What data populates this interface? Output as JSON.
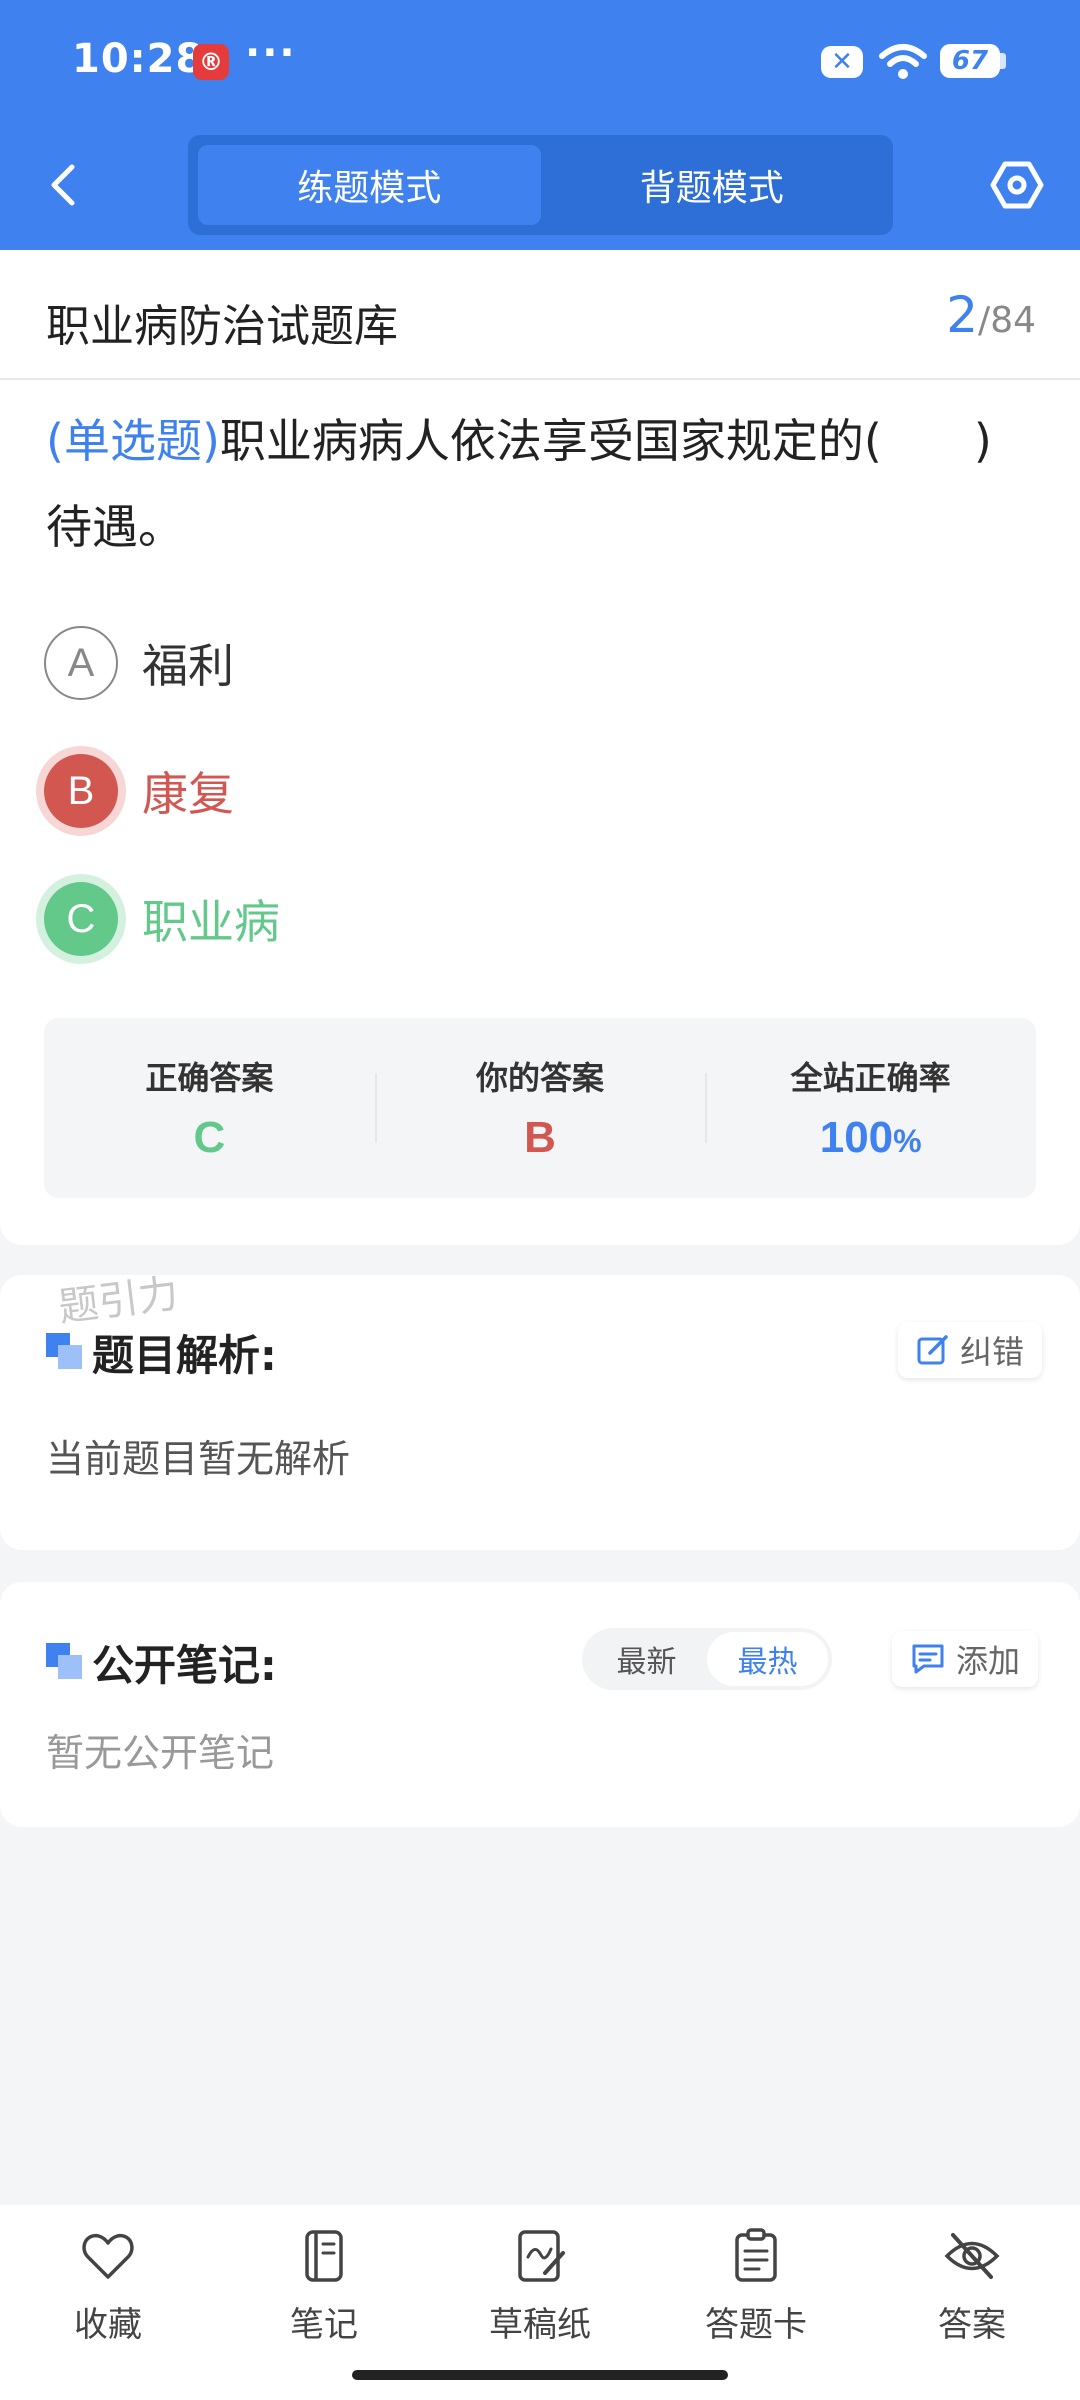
{
  "status_bar": {
    "time": "10:28",
    "app_badge": "®",
    "more": "···",
    "x_badge": "✕",
    "battery": "67"
  },
  "header": {
    "tabs": [
      {
        "label": "练题模式",
        "active": true
      },
      {
        "label": "背题模式",
        "active": false
      }
    ]
  },
  "question_header": {
    "bank_title": "职业病防治试题库",
    "current": "2",
    "separator": "/",
    "total": "84"
  },
  "question": {
    "type_label": "(单选题)",
    "text": "职业病病人依法享受国家规定的(　　)待遇。"
  },
  "options": [
    {
      "letter": "A",
      "text": "福利",
      "state": "normal"
    },
    {
      "letter": "B",
      "text": "康复",
      "state": "wrong"
    },
    {
      "letter": "C",
      "text": "职业病",
      "state": "correct"
    }
  ],
  "stats": {
    "correct_label": "正确答案",
    "correct_value": "C",
    "yours_label": "你的答案",
    "yours_value": "B",
    "rate_label": "全站正确率",
    "rate_value": "100",
    "rate_unit": "%"
  },
  "analysis": {
    "watermark": "题引力",
    "title": "题目解析:",
    "report_label": "纠错",
    "empty_text": "当前题目暂无解析"
  },
  "notes": {
    "title": "公开笔记:",
    "sort_options": [
      {
        "label": "最新",
        "active": false
      },
      {
        "label": "最热",
        "active": true
      }
    ],
    "add_label": "添加",
    "empty_text": "暂无公开笔记"
  },
  "bottom_nav": [
    {
      "label": "收藏",
      "icon": "heart-icon"
    },
    {
      "label": "笔记",
      "icon": "notebook-icon"
    },
    {
      "label": "草稿纸",
      "icon": "draft-paper-icon"
    },
    {
      "label": "答题卡",
      "icon": "answer-card-icon"
    },
    {
      "label": "答案",
      "icon": "eye-off-icon"
    }
  ],
  "colors": {
    "primary": "#3f82ef",
    "wrong": "#d25751",
    "correct": "#63c98a"
  }
}
